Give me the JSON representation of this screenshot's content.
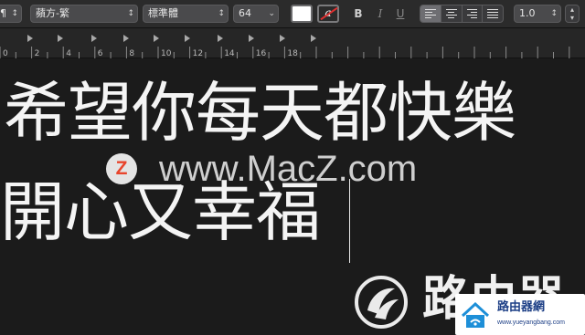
{
  "toolbar": {
    "paragraph_style": "¶",
    "font_family": "蘋方-繁",
    "typeface": "標準體",
    "font_size": "64",
    "bold": "B",
    "italic": "I",
    "underline": "U",
    "line_spacing": "1.0",
    "text_color": "#ffffff",
    "highlight_icon": "a",
    "alignment_selected": "left"
  },
  "ruler": {
    "labels": [
      "0",
      "2",
      "4",
      "6",
      "8",
      "10",
      "12",
      "14",
      "16",
      "18"
    ]
  },
  "document": {
    "line1": "希望你每天都快樂",
    "line2": "開心又幸福"
  },
  "watermark": {
    "logo_letter": "Z",
    "site": "www.MacZ.com"
  },
  "corner_brand": {
    "cjk": "路由器",
    "badge_title": "路由器網",
    "badge_url": "www.yueyangbang.com"
  }
}
